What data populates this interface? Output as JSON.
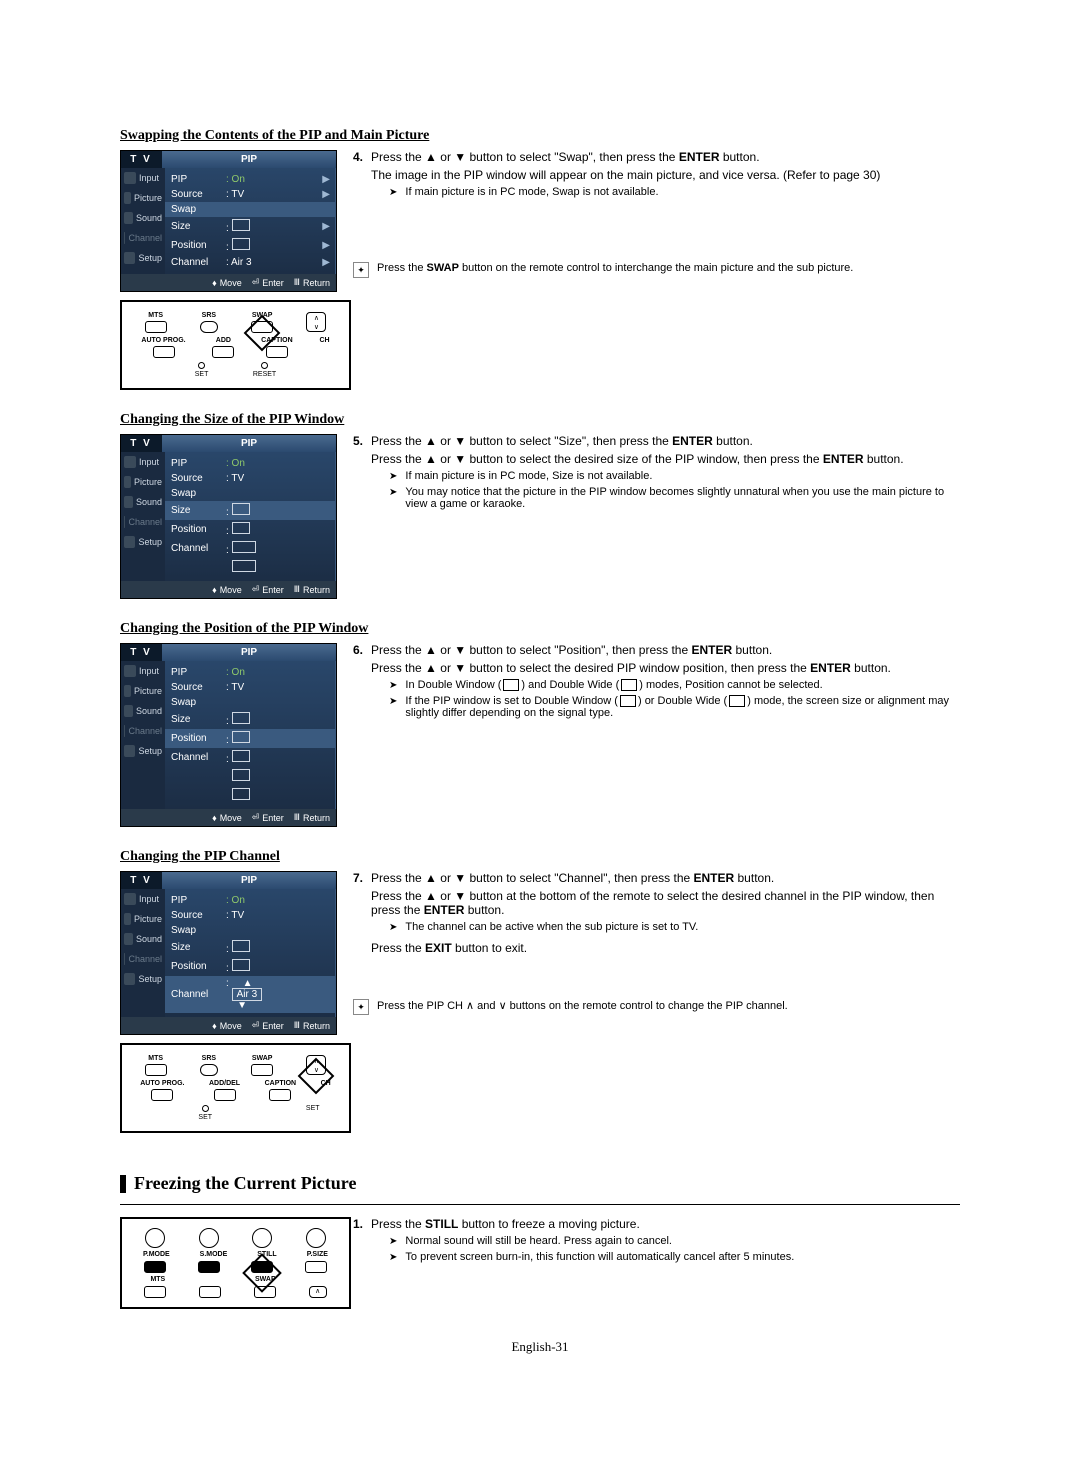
{
  "headings": {
    "swap": "Swapping the Contents of the PIP and Main Picture",
    "size": "Changing the Size of the PIP Window",
    "position": "Changing the Position of the PIP Window",
    "channel": "Changing the PIP Channel",
    "freeze": "Freezing the Current Picture"
  },
  "osd": {
    "tv_label": "T V",
    "pip_label": "PIP",
    "side": {
      "input": "Input",
      "picture": "Picture",
      "sound": "Sound",
      "channel": "Channel",
      "setup": "Setup"
    },
    "rows": {
      "pip": "PIP",
      "source": "Source",
      "swap": "Swap",
      "size": "Size",
      "position": "Position",
      "channel": "Channel",
      "on": ": On",
      "tv": ": TV",
      "air3": ": Air 3",
      "air3_boxed": "Air 3"
    },
    "footer": {
      "move": "Move",
      "enter": "Enter",
      "return": "Return"
    }
  },
  "remote": {
    "mts": "MTS",
    "srs": "SRS",
    "swap": "SWAP",
    "autoprog": "AUTO PROG.",
    "add": "ADD",
    "adddel": "ADD/DEL",
    "caption": "CAPTION",
    "ch": "CH",
    "set": "SET",
    "reset": "RESET",
    "pmode": "P.MODE",
    "smode": "S.MODE",
    "still": "STILL",
    "psize": "P.SIZE"
  },
  "steps": {
    "s4": {
      "num": "4.",
      "l1_a": "Press the ",
      "l1_b": " or ",
      "l1_c": " button to select \"Swap\", then press the ",
      "enter": "ENTER",
      "l1_d": " button.",
      "l2": "The image in the PIP window will appear on the main picture, and vice versa. (Refer to page 30)",
      "note1": "If main picture is in PC mode, Swap is not available.",
      "remote_a": "Press the ",
      "swap_b": "SWAP",
      "remote_b": " button on the remote control to interchange the main picture and the sub picture."
    },
    "s5": {
      "num": "5.",
      "l1_a": "Press the ",
      "l1_b": " or ",
      "l1_c": " button to select \"Size\", then press the ",
      "enter": "ENTER",
      "l1_d": " button.",
      "l2_a": "Press the ",
      "l2_b": " or ",
      "l2_c": " button to select the desired size of the PIP window, then press the ",
      "l2_d": " button.",
      "note1": "If main picture is in PC mode, Size is not available.",
      "note2": "You may notice that the picture in the PIP window becomes slightly unnatural when you use the main picture to view a game or karaoke."
    },
    "s6": {
      "num": "6.",
      "l1_a": "Press the ",
      "l1_b": " or ",
      "l1_c": " button to select \"Position\", then press the ",
      "enter": "ENTER",
      "l1_d": " button.",
      "l2_a": "Press the ",
      "l2_b": " or ",
      "l2_c": " button to select the desired PIP window position, then press the ",
      "l2_d": " button.",
      "note1_a": "In Double Window (",
      "note1_b": ") and Double Wide (",
      "note1_c": ") modes, Position cannot be selected.",
      "note2_a": "If the PIP window is set to Double Window (",
      "note2_b": ") or Double Wide (",
      "note2_c": ") mode, the screen size or alignment may slightly differ depending on the signal type."
    },
    "s7": {
      "num": "7.",
      "l1_a": "Press the ",
      "l1_b": " or ",
      "l1_c": " button to select \"Channel\", then press the ",
      "enter": "ENTER",
      "l1_d": " button.",
      "l2_a": "Press the ",
      "l2_b": " or ",
      "l2_c": " button at the bottom of the remote to select the desired channel in the PIP window, then press the ",
      "l2_d": " button.",
      "note1": "The channel can be active when the sub picture is set to TV.",
      "exit_a": "Press the ",
      "exit_b": "EXIT",
      "exit_c": " button to exit.",
      "remote": "Press the PIP CH ∧ and ∨ buttons on the remote control to change the PIP channel."
    },
    "freeze": {
      "num": "1.",
      "l1_a": "Press the ",
      "still": "STILL",
      "l1_b": " button to freeze a moving picture.",
      "note1": "Normal sound will still be heard. Press again to cancel.",
      "note2": "To prevent screen burn-in, this function will automatically cancel after 5 minutes."
    }
  },
  "footer": "English-31"
}
